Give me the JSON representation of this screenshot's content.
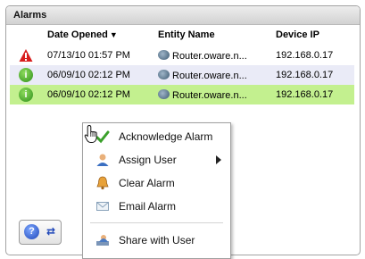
{
  "panel": {
    "title": "Alarms"
  },
  "table": {
    "columns": [
      "Date Opened",
      "Entity Name",
      "Device IP"
    ],
    "sort_indicator": "▼",
    "rows": [
      {
        "severity": "critical",
        "date": "07/13/10 01:57 PM",
        "entity": "Router.oware.n...",
        "ip": "192.168.0.17"
      },
      {
        "severity": "info",
        "date": "06/09/10 02:12 PM",
        "entity": "Router.oware.n...",
        "ip": "192.168.0.17"
      },
      {
        "severity": "info",
        "date": "06/09/10 02:12 PM",
        "entity": "Router.oware.n...",
        "ip": "192.168.0.17"
      }
    ]
  },
  "context_menu": {
    "items": [
      {
        "label": "Acknowledge Alarm",
        "icon": "acknowledge-icon"
      },
      {
        "label": "Assign User",
        "icon": "user-icon",
        "submenu": true
      },
      {
        "label": "Clear Alarm",
        "icon": "bell-icon"
      },
      {
        "label": "Email Alarm",
        "icon": "envelope-icon"
      },
      {
        "label": "Share with User",
        "icon": "share-user-icon"
      }
    ]
  },
  "toolbar": {
    "help_icon": "?",
    "swap_icon": "⇄"
  },
  "colors": {
    "selected_row": "#c3f08f",
    "alt_row": "#eaebf7",
    "critical": "#d81e1e",
    "info": "#2e8f1a"
  }
}
